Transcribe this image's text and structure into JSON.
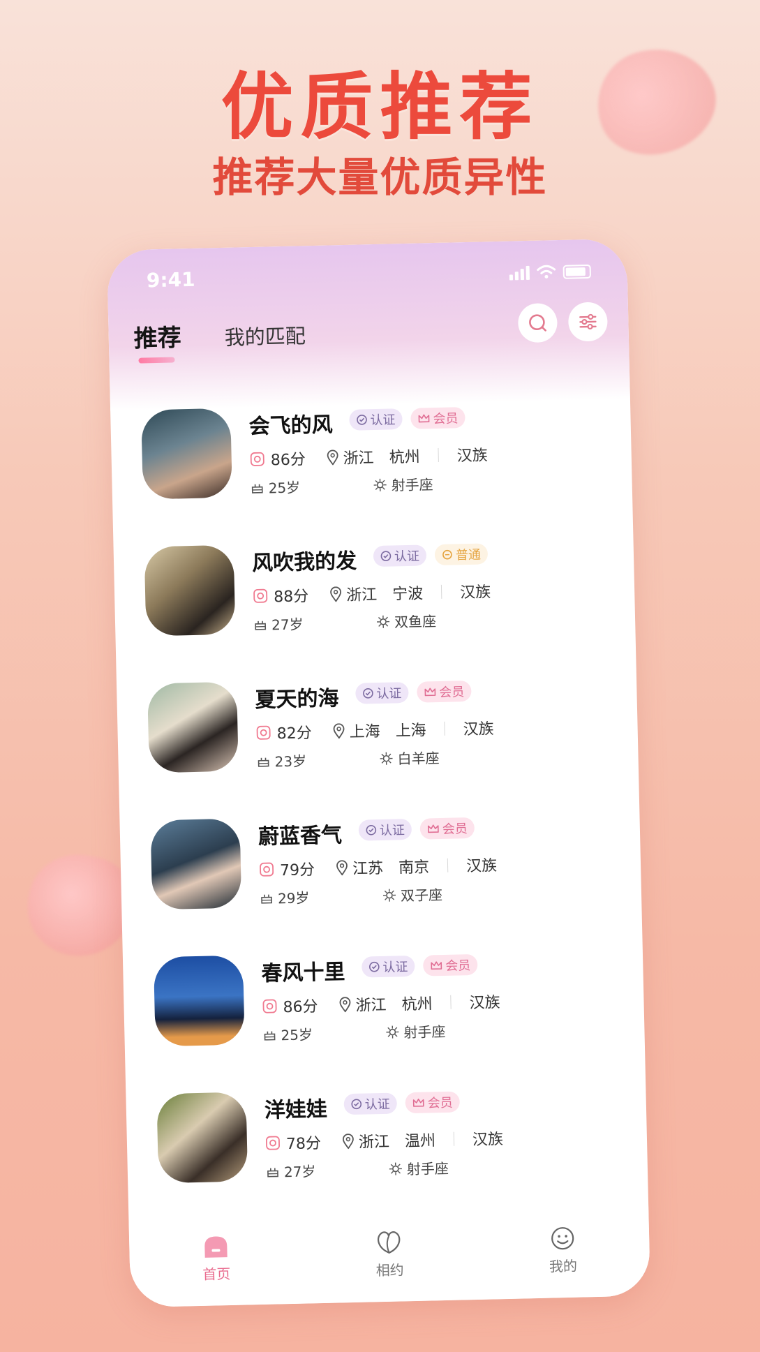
{
  "promo": {
    "headline": "优质推荐",
    "subheadline": "推荐大量优质异性"
  },
  "status_bar": {
    "time": "9:41"
  },
  "header": {
    "tabs": [
      {
        "label": "推荐",
        "active": true
      },
      {
        "label": "我的匹配",
        "active": false
      }
    ],
    "icons": [
      "search-icon",
      "filter-icon"
    ]
  },
  "badges": {
    "verified": "认证",
    "member": "会员",
    "normal": "普通"
  },
  "users": [
    {
      "name": "会飞的风",
      "tier": "member",
      "score": "86分",
      "province": "浙江",
      "city": "杭州",
      "ethnicity": "汉族",
      "age": "25岁",
      "zodiac": "射手座"
    },
    {
      "name": "风吹我的发",
      "tier": "normal",
      "score": "88分",
      "province": "浙江",
      "city": "宁波",
      "ethnicity": "汉族",
      "age": "27岁",
      "zodiac": "双鱼座"
    },
    {
      "name": "夏天的海",
      "tier": "member",
      "score": "82分",
      "province": "上海",
      "city": "上海",
      "ethnicity": "汉族",
      "age": "23岁",
      "zodiac": "白羊座"
    },
    {
      "name": "蔚蓝香气",
      "tier": "member",
      "score": "79分",
      "province": "江苏",
      "city": "南京",
      "ethnicity": "汉族",
      "age": "29岁",
      "zodiac": "双子座"
    },
    {
      "name": "春风十里",
      "tier": "member",
      "score": "86分",
      "province": "浙江",
      "city": "杭州",
      "ethnicity": "汉族",
      "age": "25岁",
      "zodiac": "射手座"
    },
    {
      "name": "洋娃娃",
      "tier": "member",
      "score": "78分",
      "province": "浙江",
      "city": "温州",
      "ethnicity": "汉族",
      "age": "27岁",
      "zodiac": "射手座"
    }
  ],
  "tab_bar": [
    {
      "label": "首页",
      "icon": "home-icon",
      "active": true
    },
    {
      "label": "相约",
      "icon": "heart-leaf-icon",
      "active": false
    },
    {
      "label": "我的",
      "icon": "smiley-icon",
      "active": false
    }
  ],
  "colors": {
    "headline": "#ec4a3c",
    "accent": "#e96b8e",
    "verified_bg": "#efe6f8",
    "member_bg": "#fde3ec"
  }
}
